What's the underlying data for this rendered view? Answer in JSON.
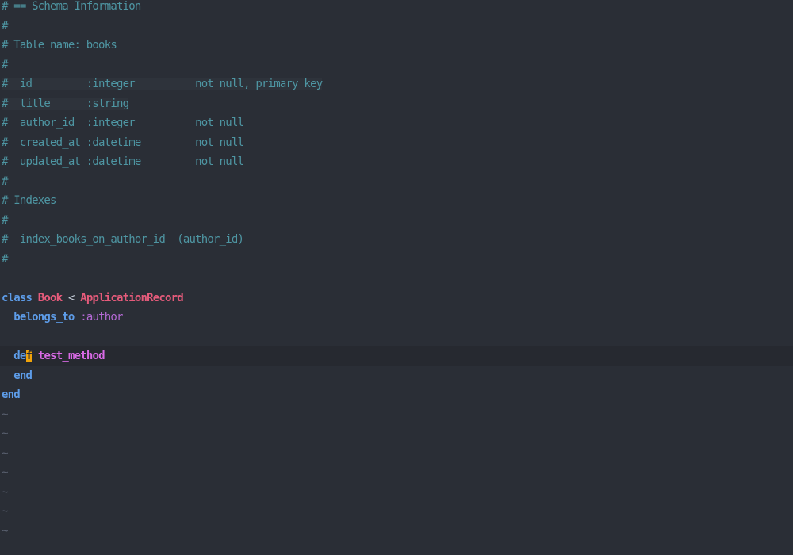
{
  "comment_block": [
    "# == Schema Information",
    "#",
    "# Table name: books",
    "#",
    "#  id         :integer          not null, primary key",
    "#  title      :string",
    "#  author_id  :integer          not null",
    "#  created_at :datetime         not null",
    "#  updated_at :datetime         not null",
    "#",
    "# Indexes",
    "#",
    "#  index_books_on_author_id  (author_id)",
    "#"
  ],
  "code": {
    "class_keyword": "class",
    "class_name": "Book",
    "inherit_op": " < ",
    "superclass": "ApplicationRecord",
    "belongs_to_keyword": "belongs_to",
    "belongs_to_symbol": ":author",
    "def_keyword_before_cursor": "de",
    "cursor_char": "f",
    "method_name": "test_method",
    "inner_end": "end",
    "outer_end": "end"
  },
  "empty_line_marker": "~",
  "colors": {
    "background": "#2a2e36",
    "comment": "#4e96a3",
    "keyword": "#5d9ce8",
    "class": "#e65b7b",
    "symbol": "#b56ad6",
    "method": "#d96ae6",
    "cursor": "#f0a30a"
  }
}
